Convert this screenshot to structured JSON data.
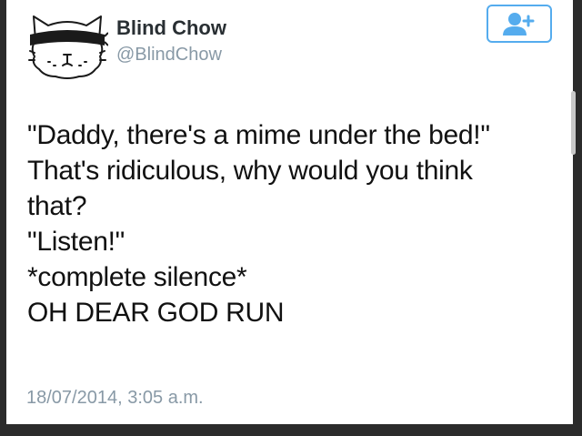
{
  "user": {
    "display_name": "Blind Chow",
    "handle": "@BlindChow",
    "avatar_icon": "blindfolded-cat-avatar-icon"
  },
  "follow_button": {
    "icon": "add-user-icon",
    "color": "#55acee"
  },
  "tweet": {
    "lines": [
      "\"Daddy, there's a mime under the bed!\"",
      "That's ridiculous, why would you think",
      "that?",
      "\"Listen!\"",
      "*complete silence*",
      "OH DEAR GOD RUN"
    ],
    "timestamp": "18/07/2014, 3:05 a.m."
  }
}
